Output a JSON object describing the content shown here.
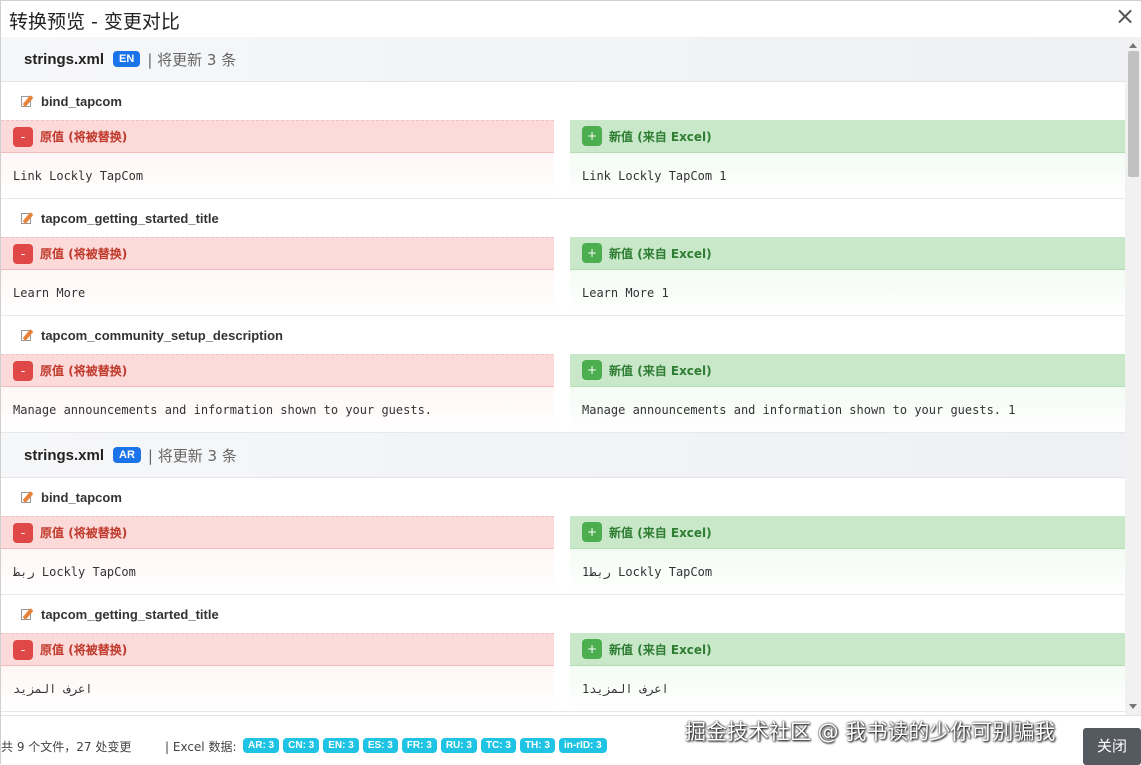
{
  "dialog": {
    "title": "转换预览 - 变更对比",
    "close_glyph": "×"
  },
  "labels": {
    "old": "原值",
    "old_note": "(将被替换)",
    "new": "新值",
    "new_note": "(来自 Excel)",
    "minus": "-",
    "plus": "+"
  },
  "files": [
    {
      "name": "strings.xml",
      "lang": "EN",
      "meta": "| 将更新 3 条",
      "entries": [
        {
          "key": "bind_tapcom",
          "old": "Link Lockly TapCom",
          "new": "Link Lockly TapCom 1"
        },
        {
          "key": "tapcom_getting_started_title",
          "old": "Learn More",
          "new": "Learn More 1"
        },
        {
          "key": "tapcom_community_setup_description",
          "old": "Manage announcements and information shown to your guests.",
          "new": "Manage announcements and information shown to your guests. 1"
        }
      ]
    },
    {
      "name": "strings.xml",
      "lang": "AR",
      "meta": "| 将更新 3 条",
      "entries": [
        {
          "key": "bind_tapcom",
          "old": "ربط Lockly TapCom",
          "new": "ربط1 Lockly TapCom"
        },
        {
          "key": "tapcom_getting_started_title",
          "old": "اعرف المزيد",
          "new": "اعرف المزيد1"
        }
      ]
    }
  ],
  "footer": {
    "summary": "共 9 个文件，27 处变更",
    "excel_label": "| Excel 数据:",
    "chips": [
      "AR: 3",
      "CN: 3",
      "EN: 3",
      "ES: 3",
      "FR: 3",
      "RU: 3",
      "TC: 3",
      "TH: 3",
      "in-rID: 3"
    ],
    "close_label": "关闭",
    "watermark": "掘金技术社区 @ 我书读的少你可别骗我"
  },
  "colors": {
    "old_header": "#fcdada",
    "new_header": "#c9e8c9",
    "badge": "#1a73e8",
    "chip": "#1fc4e4"
  },
  "icons": {
    "key": "edit-document-icon",
    "close": "close-icon"
  }
}
